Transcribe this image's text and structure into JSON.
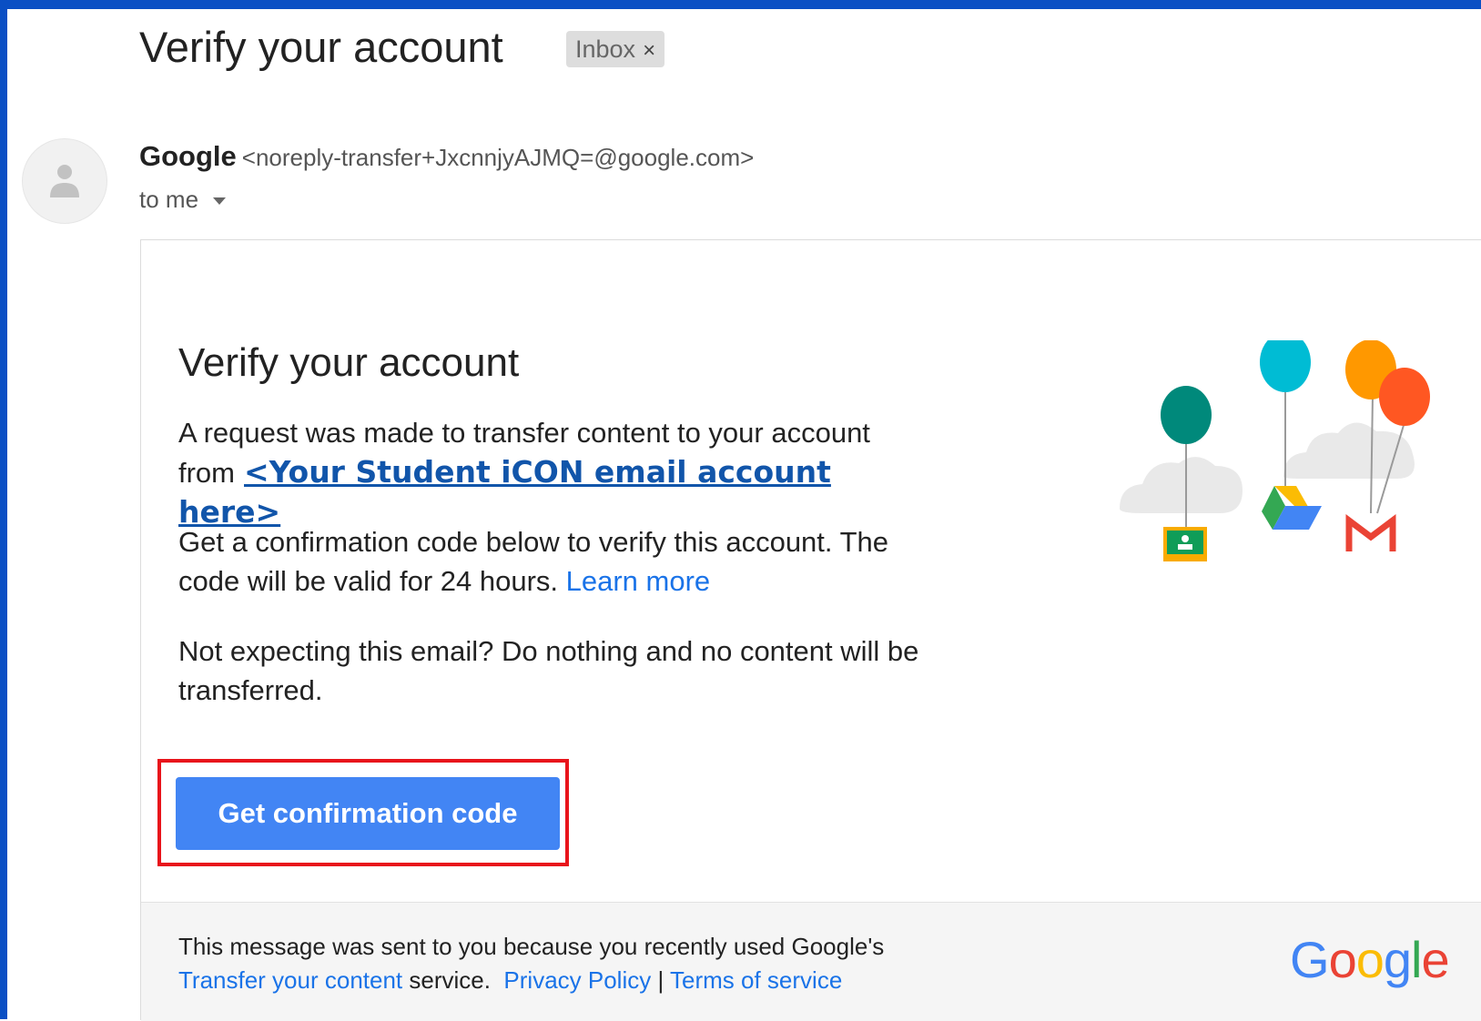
{
  "email": {
    "subject": "Verify your account",
    "label_chip": "Inbox",
    "label_chip_remove_icon": "×",
    "sender_name": "Google",
    "sender_email": "<noreply-transfer+JxcnnjyAJMQ=@google.com>",
    "recipient": "to me",
    "avatar_icon": "person-icon"
  },
  "body": {
    "title": "Verify your account",
    "paragraph1_text": "A request was made to transfer content to your account from",
    "paragraph1_link": "<Your Student iCON email account here>",
    "paragraph2_text": "Get a confirmation code below to verify this account. The code will be valid for 24 hours.",
    "paragraph2_link": "Learn more",
    "paragraph3_text": "Not expecting this email? Do nothing and no content will be transferred.",
    "cta_label": "Get confirmation code",
    "illustration_icons": [
      "balloon-icon",
      "classroom-icon",
      "drive-icon",
      "gmail-icon",
      "cloud-icon"
    ]
  },
  "footer": {
    "notice_text": "This message was sent to you because you recently used Google's",
    "transfer_link": "Transfer your content",
    "service_text": "service.",
    "privacy_link": "Privacy Policy",
    "separator": "|",
    "terms_link": "Terms of service",
    "logo_letters": [
      "G",
      "o",
      "o",
      "g",
      "l",
      "e"
    ]
  },
  "colors": {
    "frame": "#0a4fc4",
    "cta": "#4285f4",
    "highlight": "#e8141b",
    "link": "#1a73e8",
    "placeholder_link": "#1155aa"
  }
}
